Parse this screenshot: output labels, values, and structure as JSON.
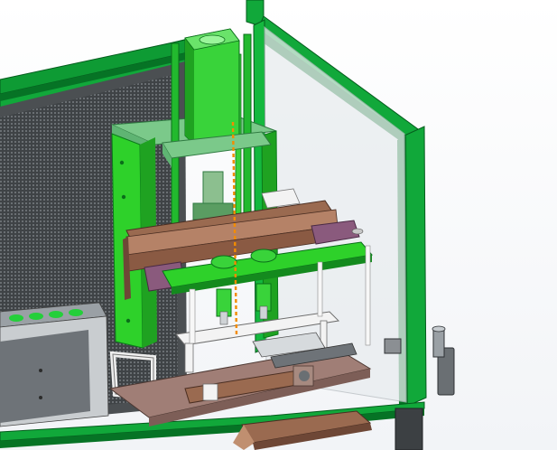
{
  "window": {
    "kind": "cad-3d-viewport"
  },
  "colors": {
    "background": "#ffffff",
    "frame_green": "#11a83a",
    "frame_green_dark": "#067325",
    "machine_green": "#2ed12a",
    "plate_green": "#7bc98a",
    "mesh": "#4b4f52",
    "wood": "#9a6a50",
    "wood_dark": "#6e4736",
    "purple_block": "#8a5a7d",
    "base_plate": "#a07e76",
    "white_part": "#f3f3f3",
    "steel": "#9aa0a5",
    "axis_line": "#f28c00"
  },
  "icons": {
    "axis": "dashed-axis-line",
    "cylinder": "pneumatic-cylinder-icon"
  }
}
